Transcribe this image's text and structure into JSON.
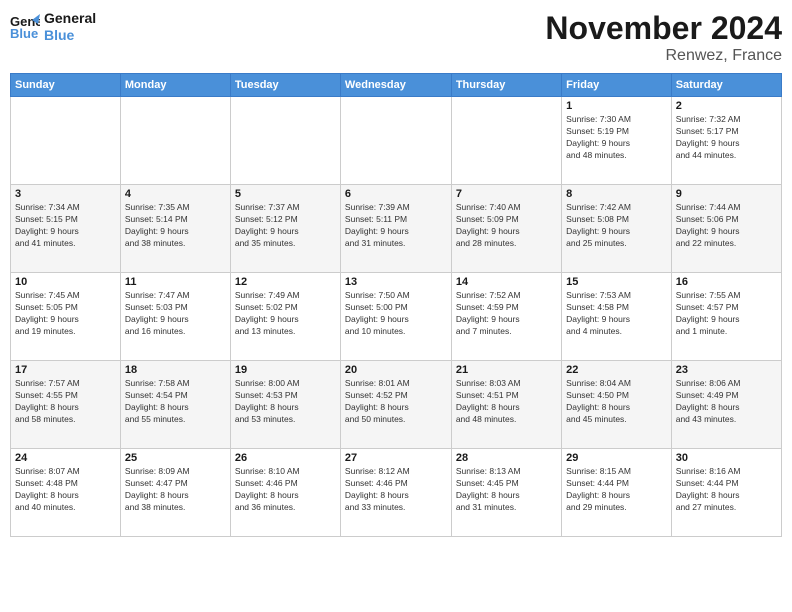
{
  "logo": {
    "line1": "General",
    "line2": "Blue"
  },
  "title": "November 2024",
  "subtitle": "Renwez, France",
  "days_header": [
    "Sunday",
    "Monday",
    "Tuesday",
    "Wednesday",
    "Thursday",
    "Friday",
    "Saturday"
  ],
  "weeks": [
    [
      {
        "day": "",
        "info": ""
      },
      {
        "day": "",
        "info": ""
      },
      {
        "day": "",
        "info": ""
      },
      {
        "day": "",
        "info": ""
      },
      {
        "day": "",
        "info": ""
      },
      {
        "day": "1",
        "info": "Sunrise: 7:30 AM\nSunset: 5:19 PM\nDaylight: 9 hours\nand 48 minutes."
      },
      {
        "day": "2",
        "info": "Sunrise: 7:32 AM\nSunset: 5:17 PM\nDaylight: 9 hours\nand 44 minutes."
      }
    ],
    [
      {
        "day": "3",
        "info": "Sunrise: 7:34 AM\nSunset: 5:15 PM\nDaylight: 9 hours\nand 41 minutes."
      },
      {
        "day": "4",
        "info": "Sunrise: 7:35 AM\nSunset: 5:14 PM\nDaylight: 9 hours\nand 38 minutes."
      },
      {
        "day": "5",
        "info": "Sunrise: 7:37 AM\nSunset: 5:12 PM\nDaylight: 9 hours\nand 35 minutes."
      },
      {
        "day": "6",
        "info": "Sunrise: 7:39 AM\nSunset: 5:11 PM\nDaylight: 9 hours\nand 31 minutes."
      },
      {
        "day": "7",
        "info": "Sunrise: 7:40 AM\nSunset: 5:09 PM\nDaylight: 9 hours\nand 28 minutes."
      },
      {
        "day": "8",
        "info": "Sunrise: 7:42 AM\nSunset: 5:08 PM\nDaylight: 9 hours\nand 25 minutes."
      },
      {
        "day": "9",
        "info": "Sunrise: 7:44 AM\nSunset: 5:06 PM\nDaylight: 9 hours\nand 22 minutes."
      }
    ],
    [
      {
        "day": "10",
        "info": "Sunrise: 7:45 AM\nSunset: 5:05 PM\nDaylight: 9 hours\nand 19 minutes."
      },
      {
        "day": "11",
        "info": "Sunrise: 7:47 AM\nSunset: 5:03 PM\nDaylight: 9 hours\nand 16 minutes."
      },
      {
        "day": "12",
        "info": "Sunrise: 7:49 AM\nSunset: 5:02 PM\nDaylight: 9 hours\nand 13 minutes."
      },
      {
        "day": "13",
        "info": "Sunrise: 7:50 AM\nSunset: 5:00 PM\nDaylight: 9 hours\nand 10 minutes."
      },
      {
        "day": "14",
        "info": "Sunrise: 7:52 AM\nSunset: 4:59 PM\nDaylight: 9 hours\nand 7 minutes."
      },
      {
        "day": "15",
        "info": "Sunrise: 7:53 AM\nSunset: 4:58 PM\nDaylight: 9 hours\nand 4 minutes."
      },
      {
        "day": "16",
        "info": "Sunrise: 7:55 AM\nSunset: 4:57 PM\nDaylight: 9 hours\nand 1 minute."
      }
    ],
    [
      {
        "day": "17",
        "info": "Sunrise: 7:57 AM\nSunset: 4:55 PM\nDaylight: 8 hours\nand 58 minutes."
      },
      {
        "day": "18",
        "info": "Sunrise: 7:58 AM\nSunset: 4:54 PM\nDaylight: 8 hours\nand 55 minutes."
      },
      {
        "day": "19",
        "info": "Sunrise: 8:00 AM\nSunset: 4:53 PM\nDaylight: 8 hours\nand 53 minutes."
      },
      {
        "day": "20",
        "info": "Sunrise: 8:01 AM\nSunset: 4:52 PM\nDaylight: 8 hours\nand 50 minutes."
      },
      {
        "day": "21",
        "info": "Sunrise: 8:03 AM\nSunset: 4:51 PM\nDaylight: 8 hours\nand 48 minutes."
      },
      {
        "day": "22",
        "info": "Sunrise: 8:04 AM\nSunset: 4:50 PM\nDaylight: 8 hours\nand 45 minutes."
      },
      {
        "day": "23",
        "info": "Sunrise: 8:06 AM\nSunset: 4:49 PM\nDaylight: 8 hours\nand 43 minutes."
      }
    ],
    [
      {
        "day": "24",
        "info": "Sunrise: 8:07 AM\nSunset: 4:48 PM\nDaylight: 8 hours\nand 40 minutes."
      },
      {
        "day": "25",
        "info": "Sunrise: 8:09 AM\nSunset: 4:47 PM\nDaylight: 8 hours\nand 38 minutes."
      },
      {
        "day": "26",
        "info": "Sunrise: 8:10 AM\nSunset: 4:46 PM\nDaylight: 8 hours\nand 36 minutes."
      },
      {
        "day": "27",
        "info": "Sunrise: 8:12 AM\nSunset: 4:46 PM\nDaylight: 8 hours\nand 33 minutes."
      },
      {
        "day": "28",
        "info": "Sunrise: 8:13 AM\nSunset: 4:45 PM\nDaylight: 8 hours\nand 31 minutes."
      },
      {
        "day": "29",
        "info": "Sunrise: 8:15 AM\nSunset: 4:44 PM\nDaylight: 8 hours\nand 29 minutes."
      },
      {
        "day": "30",
        "info": "Sunrise: 8:16 AM\nSunset: 4:44 PM\nDaylight: 8 hours\nand 27 minutes."
      }
    ]
  ]
}
